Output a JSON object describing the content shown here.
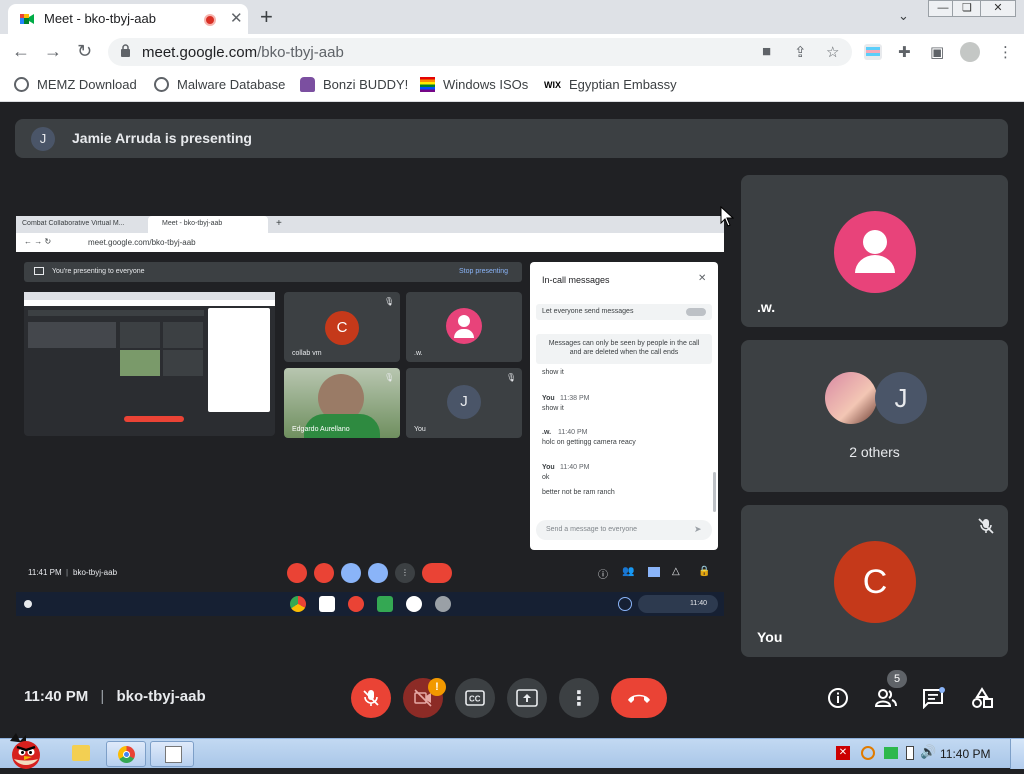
{
  "browser": {
    "tab_title": "Meet - bko-tbyj-aab",
    "new_tab": "+",
    "url_host": "meet.google.com",
    "url_path": "/bko-tbyj-aab",
    "window_controls": [
      "—",
      "❏",
      "✕"
    ],
    "bookmarks": [
      {
        "label": "MEMZ Download",
        "icon": "globe-icon"
      },
      {
        "label": "Malware Database",
        "icon": "globe-icon"
      },
      {
        "label": "Bonzi BUDDY!",
        "icon": "bonzi-icon"
      },
      {
        "label": "Windows ISOs",
        "icon": "rainbow-flag-icon"
      },
      {
        "label": "Egyptian Embassy",
        "icon": "wix-icon"
      }
    ],
    "wix_text": "WIX"
  },
  "meet": {
    "presenting_avatar": "J",
    "presenting_text": "Jamie Arruda is presenting",
    "time": "11:40 PM",
    "separator": "|",
    "meeting_code": "bko-tbyj-aab",
    "participant_count": "5",
    "camera_warning": "!",
    "tiles": [
      {
        "name": ".w.",
        "avatar_color": "#e8437a"
      },
      {
        "name": "2 others",
        "avatar_letter": "J"
      },
      {
        "name": "You",
        "avatar_letter": "C",
        "avatar_color": "#c5391a"
      }
    ]
  },
  "screen": {
    "tab1": "Combat Collaborative Virtual M...",
    "tab2": "Meet - bko-tbyj-aab",
    "url": "meet.google.com/bko-tbyj-aab",
    "presenting_msg": "You're presenting to everyone",
    "stop_presenting": "Stop presenting",
    "tiles": [
      {
        "name": "collab vm",
        "letter": "C"
      },
      {
        "name": ".w.",
        "letter": ""
      },
      {
        "name": "Edgardo Aurellano",
        "letter": ""
      },
      {
        "name": "You",
        "letter": "J"
      }
    ],
    "chat": {
      "title": "In-call messages",
      "toggle_label": "Let everyone send messages",
      "notice": "Messages can only be seen by people in the call and are deleted when the call ends",
      "messages": [
        {
          "sender": "",
          "time": "",
          "text": "show it"
        },
        {
          "sender": "You",
          "time": "11:38 PM",
          "text": "show it"
        },
        {
          "sender": ".w.",
          "time": "11:40 PM",
          "text": "holc on gettingg camera reacy"
        },
        {
          "sender": "You",
          "time": "11:40 PM",
          "text": "ok"
        },
        {
          "sender": "",
          "time": "",
          "text": "better not be ram ranch"
        }
      ],
      "input_placeholder": "Send a message to everyone"
    },
    "bottom_time": "11:41 PM",
    "bottom_code": "bko-tbyj-aab",
    "shelf_time": "11:40"
  },
  "taskbar": {
    "clock": "11:40 PM"
  },
  "colors": {
    "accent_red": "#ea4335",
    "bg": "#202124",
    "tile": "#3c4043"
  }
}
